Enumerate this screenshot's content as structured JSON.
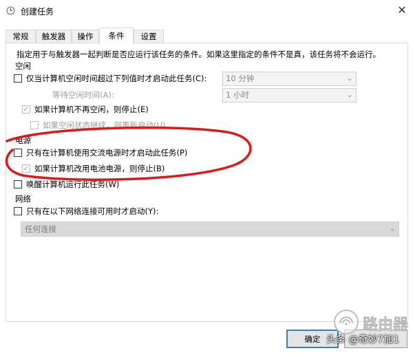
{
  "window": {
    "title": "创建任务",
    "close_glyph": "✕"
  },
  "tabs": [
    {
      "label": "常规"
    },
    {
      "label": "触发器"
    },
    {
      "label": "操作"
    },
    {
      "label": "条件",
      "active": true
    },
    {
      "label": "设置"
    }
  ],
  "conditions": {
    "intro": "指定用于与触发器一起判断是否应运行该任务的条件。如果这里指定的条件不是真，该任务将不会运行。",
    "idle": {
      "section_label": "空闲",
      "start_if_idle": {
        "label": "仅当计算机空闲时间超过下列值时才启动此任务(C):",
        "checked": false
      },
      "idle_duration": {
        "value": "10 分钟"
      },
      "wait_label": "等待空闲时间(A):",
      "wait_value": "1 小时",
      "stop_if_not_idle": {
        "label": "如果计算机不再空闲，则停止(E)",
        "checked": true,
        "disabled": true
      },
      "restart_if_idle_resumes": {
        "label": "如果空闲状态继续，则重新启动(U)",
        "checked": false,
        "disabled": true
      }
    },
    "power": {
      "section_label": "电源",
      "ac_only": {
        "label": "只有在计算机使用交流电源时才启动此任务(P)",
        "checked": false
      },
      "stop_on_battery": {
        "label": "如果计算机改用电池电源，则停止(B)",
        "checked": true,
        "disabled": true
      },
      "wake": {
        "label": "唤醒计算机运行此任务(W)",
        "checked": false
      }
    },
    "network": {
      "section_label": "网络",
      "network_only": {
        "label": "只有在以下网络连接可用时才启动(Y):",
        "checked": false
      },
      "connection": {
        "value": "任何连接"
      }
    }
  },
  "footer": {
    "ok_label": "确定"
  },
  "watermark": {
    "brand": "路由器",
    "line": "头条 @奇妙7加1"
  },
  "colors": {
    "annotation_red": "#e01818",
    "primary_border": "#3c7fb1"
  }
}
